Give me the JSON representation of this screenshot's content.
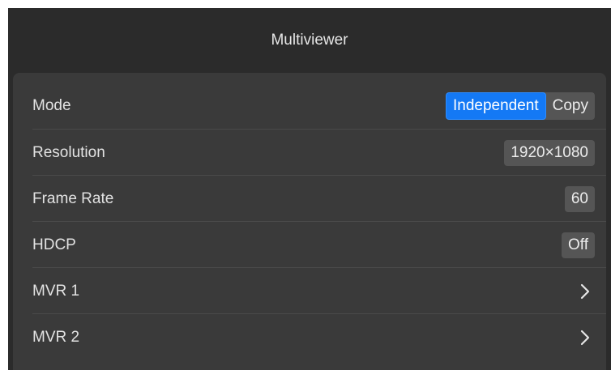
{
  "header": {
    "title": "Multiviewer"
  },
  "settings": {
    "mode": {
      "label": "Mode",
      "options": [
        "Independent",
        "Copy"
      ],
      "selected": "Independent"
    },
    "resolution": {
      "label": "Resolution",
      "value": "1920×1080"
    },
    "frame_rate": {
      "label": "Frame Rate",
      "value": "60"
    },
    "hdcp": {
      "label": "HDCP",
      "value": "Off"
    },
    "mvr1": {
      "label": "MVR 1",
      "icon": "chevron-right-icon"
    },
    "mvr2": {
      "label": "MVR 2",
      "icon": "chevron-right-icon"
    }
  },
  "colors": {
    "background": "#2b2b2b",
    "list_background": "#3a3a3a",
    "accent": "#1479f5",
    "value_box": "#555555"
  }
}
